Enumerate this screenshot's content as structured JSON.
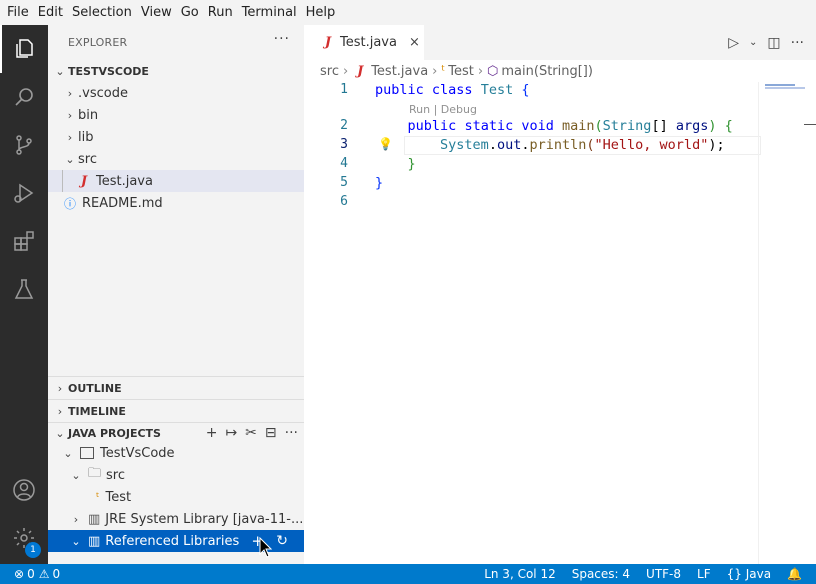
{
  "menu": [
    "File",
    "Edit",
    "Selection",
    "View",
    "Go",
    "Run",
    "Terminal",
    "Help"
  ],
  "activity": {
    "icons": [
      "explorer-icon",
      "search-icon",
      "source-control-icon",
      "run-debug-icon",
      "extensions-icon",
      "testing-icon",
      "account-icon",
      "settings-gear-icon"
    ],
    "settings_badge": "1"
  },
  "sidebar": {
    "title": "EXPLORER",
    "more": "···",
    "workspace": "TESTVSCODE",
    "tree": [
      {
        "label": ".vscode",
        "kind": "folder",
        "expanded": false
      },
      {
        "label": "bin",
        "kind": "folder",
        "expanded": false
      },
      {
        "label": "lib",
        "kind": "folder",
        "expanded": false
      },
      {
        "label": "src",
        "kind": "folder",
        "expanded": true
      },
      {
        "label": "Test.java",
        "kind": "java-file",
        "selected": true
      },
      {
        "label": "README.md",
        "kind": "info-file"
      }
    ],
    "outline": "OUTLINE",
    "timeline": "TIMELINE",
    "java_projects": {
      "title": "JAVA PROJECTS",
      "project": "TestVsCode",
      "src": "src",
      "class": "Test",
      "jre": "JRE System Library [java-11-...",
      "ref_libs": "Referenced Libraries"
    }
  },
  "editor": {
    "tab_label": "Test.java",
    "close": "×",
    "breadcrumb": [
      "src",
      "Test.java",
      "Test",
      "main(String[])"
    ],
    "line_numbers": [
      "1",
      "2",
      "3",
      "4",
      "5",
      "6"
    ],
    "codelens": "Run | Debug",
    "code": {
      "line1": {
        "kw1": "public",
        "kw2": "class",
        "name": "Test",
        "brace": "{"
      },
      "line2": {
        "kw1": "public",
        "kw2": "static",
        "kw3": "void",
        "fn": "main",
        "type": "String",
        "rest": "[]",
        "arg": "args",
        "brace": "{"
      },
      "line3": {
        "cls": "System",
        "dot1": ".",
        "field": "out",
        "dot2": ".",
        "fn": "println",
        "open": "(",
        "str": "\"Hello, world\"",
        "close": ");"
      },
      "line4": {
        "brace": "}"
      },
      "line5": {
        "brace": "}"
      }
    }
  },
  "status": {
    "errors": "0",
    "warnings": "0",
    "position": "Ln 3, Col 12",
    "spaces": "Spaces: 4",
    "encoding": "UTF-8",
    "eol": "LF",
    "language": "{} Java"
  },
  "colors": {
    "status_bg": "#007acc",
    "activity_bg": "#2c2c2c",
    "sidebar_bg": "#f3f3f3",
    "selection_bg": "#0060c0"
  }
}
